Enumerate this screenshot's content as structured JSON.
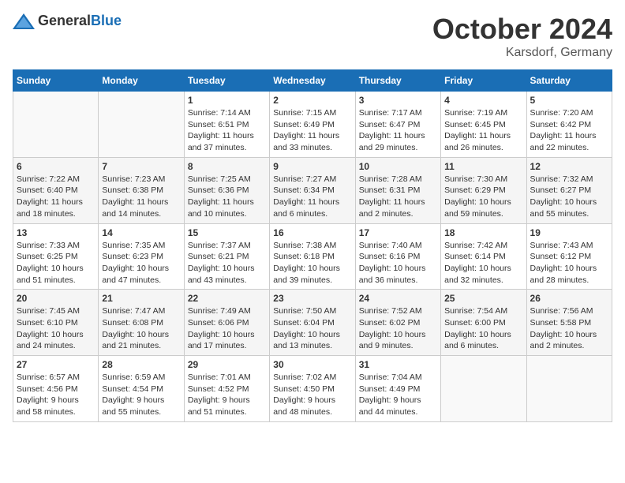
{
  "header": {
    "logo_general": "General",
    "logo_blue": "Blue",
    "month_year": "October 2024",
    "location": "Karsdorf, Germany"
  },
  "weekdays": [
    "Sunday",
    "Monday",
    "Tuesday",
    "Wednesday",
    "Thursday",
    "Friday",
    "Saturday"
  ],
  "weeks": [
    [
      {
        "day": "",
        "info": ""
      },
      {
        "day": "",
        "info": ""
      },
      {
        "day": "1",
        "info": "Sunrise: 7:14 AM\nSunset: 6:51 PM\nDaylight: 11 hours\nand 37 minutes."
      },
      {
        "day": "2",
        "info": "Sunrise: 7:15 AM\nSunset: 6:49 PM\nDaylight: 11 hours\nand 33 minutes."
      },
      {
        "day": "3",
        "info": "Sunrise: 7:17 AM\nSunset: 6:47 PM\nDaylight: 11 hours\nand 29 minutes."
      },
      {
        "day": "4",
        "info": "Sunrise: 7:19 AM\nSunset: 6:45 PM\nDaylight: 11 hours\nand 26 minutes."
      },
      {
        "day": "5",
        "info": "Sunrise: 7:20 AM\nSunset: 6:42 PM\nDaylight: 11 hours\nand 22 minutes."
      }
    ],
    [
      {
        "day": "6",
        "info": "Sunrise: 7:22 AM\nSunset: 6:40 PM\nDaylight: 11 hours\nand 18 minutes."
      },
      {
        "day": "7",
        "info": "Sunrise: 7:23 AM\nSunset: 6:38 PM\nDaylight: 11 hours\nand 14 minutes."
      },
      {
        "day": "8",
        "info": "Sunrise: 7:25 AM\nSunset: 6:36 PM\nDaylight: 11 hours\nand 10 minutes."
      },
      {
        "day": "9",
        "info": "Sunrise: 7:27 AM\nSunset: 6:34 PM\nDaylight: 11 hours\nand 6 minutes."
      },
      {
        "day": "10",
        "info": "Sunrise: 7:28 AM\nSunset: 6:31 PM\nDaylight: 11 hours\nand 2 minutes."
      },
      {
        "day": "11",
        "info": "Sunrise: 7:30 AM\nSunset: 6:29 PM\nDaylight: 10 hours\nand 59 minutes."
      },
      {
        "day": "12",
        "info": "Sunrise: 7:32 AM\nSunset: 6:27 PM\nDaylight: 10 hours\nand 55 minutes."
      }
    ],
    [
      {
        "day": "13",
        "info": "Sunrise: 7:33 AM\nSunset: 6:25 PM\nDaylight: 10 hours\nand 51 minutes."
      },
      {
        "day": "14",
        "info": "Sunrise: 7:35 AM\nSunset: 6:23 PM\nDaylight: 10 hours\nand 47 minutes."
      },
      {
        "day": "15",
        "info": "Sunrise: 7:37 AM\nSunset: 6:21 PM\nDaylight: 10 hours\nand 43 minutes."
      },
      {
        "day": "16",
        "info": "Sunrise: 7:38 AM\nSunset: 6:18 PM\nDaylight: 10 hours\nand 39 minutes."
      },
      {
        "day": "17",
        "info": "Sunrise: 7:40 AM\nSunset: 6:16 PM\nDaylight: 10 hours\nand 36 minutes."
      },
      {
        "day": "18",
        "info": "Sunrise: 7:42 AM\nSunset: 6:14 PM\nDaylight: 10 hours\nand 32 minutes."
      },
      {
        "day": "19",
        "info": "Sunrise: 7:43 AM\nSunset: 6:12 PM\nDaylight: 10 hours\nand 28 minutes."
      }
    ],
    [
      {
        "day": "20",
        "info": "Sunrise: 7:45 AM\nSunset: 6:10 PM\nDaylight: 10 hours\nand 24 minutes."
      },
      {
        "day": "21",
        "info": "Sunrise: 7:47 AM\nSunset: 6:08 PM\nDaylight: 10 hours\nand 21 minutes."
      },
      {
        "day": "22",
        "info": "Sunrise: 7:49 AM\nSunset: 6:06 PM\nDaylight: 10 hours\nand 17 minutes."
      },
      {
        "day": "23",
        "info": "Sunrise: 7:50 AM\nSunset: 6:04 PM\nDaylight: 10 hours\nand 13 minutes."
      },
      {
        "day": "24",
        "info": "Sunrise: 7:52 AM\nSunset: 6:02 PM\nDaylight: 10 hours\nand 9 minutes."
      },
      {
        "day": "25",
        "info": "Sunrise: 7:54 AM\nSunset: 6:00 PM\nDaylight: 10 hours\nand 6 minutes."
      },
      {
        "day": "26",
        "info": "Sunrise: 7:56 AM\nSunset: 5:58 PM\nDaylight: 10 hours\nand 2 minutes."
      }
    ],
    [
      {
        "day": "27",
        "info": "Sunrise: 6:57 AM\nSunset: 4:56 PM\nDaylight: 9 hours\nand 58 minutes."
      },
      {
        "day": "28",
        "info": "Sunrise: 6:59 AM\nSunset: 4:54 PM\nDaylight: 9 hours\nand 55 minutes."
      },
      {
        "day": "29",
        "info": "Sunrise: 7:01 AM\nSunset: 4:52 PM\nDaylight: 9 hours\nand 51 minutes."
      },
      {
        "day": "30",
        "info": "Sunrise: 7:02 AM\nSunset: 4:50 PM\nDaylight: 9 hours\nand 48 minutes."
      },
      {
        "day": "31",
        "info": "Sunrise: 7:04 AM\nSunset: 4:49 PM\nDaylight: 9 hours\nand 44 minutes."
      },
      {
        "day": "",
        "info": ""
      },
      {
        "day": "",
        "info": ""
      }
    ]
  ]
}
